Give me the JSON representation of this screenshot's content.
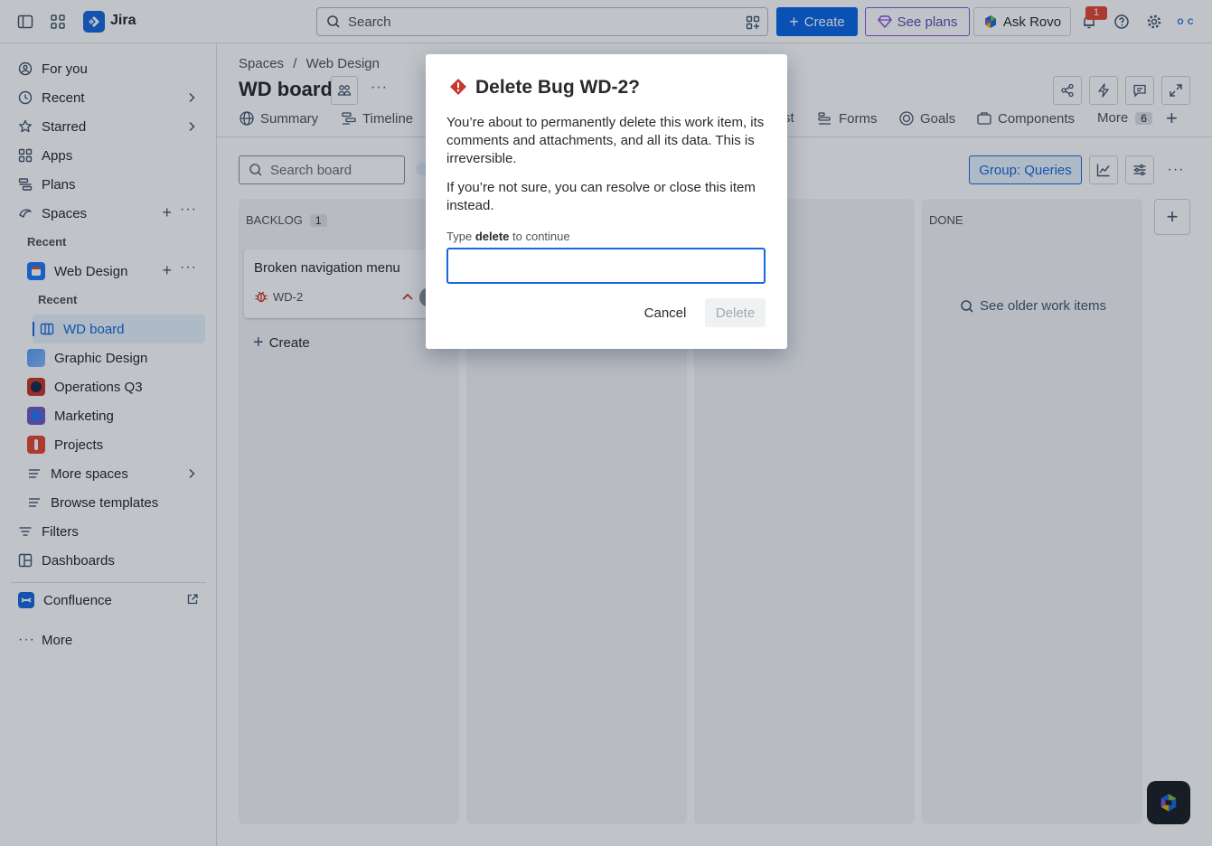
{
  "topbar": {
    "app_name": "Jira",
    "search_placeholder": "Search",
    "create_label": "Create",
    "plans_label": "See plans",
    "rovo_label": "Ask Rovo",
    "notification_count": "1",
    "avatar_text": "O C"
  },
  "sidebar": {
    "for_you": "For you",
    "recent": "Recent",
    "starred": "Starred",
    "apps": "Apps",
    "plans": "Plans",
    "spaces": "Spaces",
    "recent_section": "Recent",
    "web_design": "Web Design",
    "recent_sub": "Recent",
    "wd_board": "WD board",
    "graphic_design": "Graphic Design",
    "operations": "Operations Q3",
    "marketing": "Marketing",
    "projects": "Projects",
    "more_spaces": "More spaces",
    "browse_templates": "Browse templates",
    "filters": "Filters",
    "dashboards": "Dashboards",
    "confluence": "Confluence",
    "more": "More"
  },
  "main": {
    "breadcrumb_spaces": "Spaces",
    "breadcrumb_sep": "/",
    "breadcrumb_project": "Web Design",
    "title": "WD board",
    "tabs": {
      "summary": "Summary",
      "timeline": "Timeline",
      "list_fragment": "st",
      "forms": "Forms",
      "goals": "Goals",
      "components": "Components",
      "more": "More",
      "more_count": "6"
    },
    "search_board_placeholder": "Search board",
    "group_label": "Group: Queries",
    "columns": {
      "backlog": "BACKLOG",
      "backlog_count": "1",
      "done": "DONE"
    },
    "card": {
      "title": "Broken navigation menu",
      "key": "WD-2"
    },
    "create_label": "Create",
    "see_older": "See older work items"
  },
  "modal": {
    "title": "Delete Bug WD-2?",
    "paragraph1": "You’re about to permanently delete this work item, its comments and attachments, and all its data. This is irreversible.",
    "paragraph2": "If you’re not sure, you can resolve or close this item instead.",
    "label_prefix": "Type",
    "label_keyword": "delete",
    "label_suffix": "to continue",
    "input_value": "",
    "cancel_label": "Cancel",
    "delete_label": "Delete"
  },
  "colors": {
    "primary": "#0c66e4",
    "danger": "#c9372c",
    "selected_bg": "#e9f2fe"
  }
}
